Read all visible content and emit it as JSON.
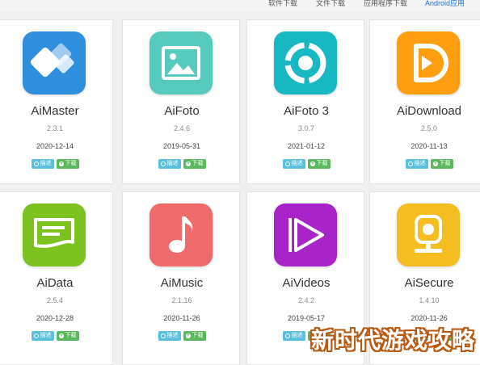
{
  "nav": {
    "tabs": [
      {
        "label": "软件下载"
      },
      {
        "label": "文件下载"
      },
      {
        "label": "应用程序下载"
      },
      {
        "label": "Android应用"
      }
    ]
  },
  "buttons": {
    "info_label": "描述",
    "download_label": "下载"
  },
  "apps": [
    {
      "name": "AiMaster",
      "version": "2.3.1",
      "date": "2020-12-14",
      "icon": "aimaster-icon",
      "color": "#2f8fde"
    },
    {
      "name": "AiFoto",
      "version": "2.4.6",
      "date": "2019-05-31",
      "icon": "aifoto-icon",
      "color": "#56cbbd"
    },
    {
      "name": "AiFoto 3",
      "version": "3.0.7",
      "date": "2021-01-12",
      "icon": "aifoto3-icon",
      "color": "#17b8c2"
    },
    {
      "name": "AiDownload",
      "version": "2.5.0",
      "date": "2020-11-13",
      "icon": "aidownload-icon",
      "color": "#ff9f0f"
    },
    {
      "name": "AiData",
      "version": "2.5.4",
      "date": "2020-12-28",
      "icon": "aidata-icon",
      "color": "#7dc21e"
    },
    {
      "name": "AiMusic",
      "version": "2.1.16",
      "date": "2020-11-26",
      "icon": "aimusic-icon",
      "color": "#ef6a6a"
    },
    {
      "name": "AiVideos",
      "version": "2.4.2",
      "date": "2019-05-17",
      "icon": "aivideos-icon",
      "color": "#a824c9"
    },
    {
      "name": "AiSecure",
      "version": "1.4.10",
      "date": "2020-11-26",
      "icon": "aisecure-icon",
      "color": "#f4be21"
    }
  ],
  "watermark": "新时代游戏攻略"
}
